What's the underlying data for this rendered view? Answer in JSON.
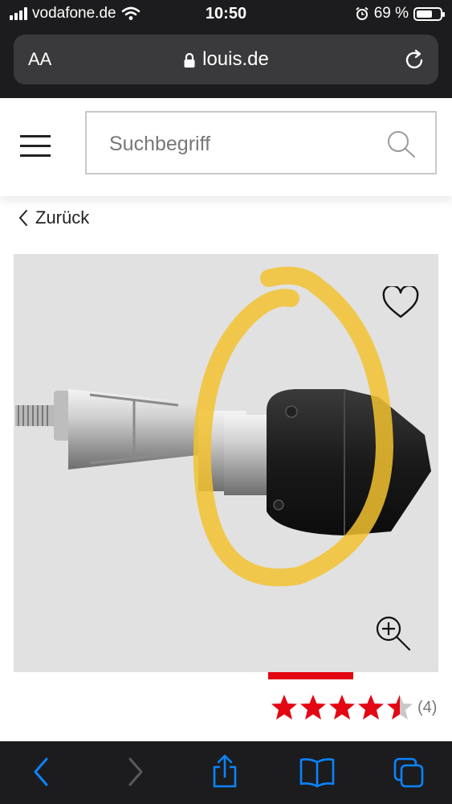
{
  "status": {
    "carrier": "vodafone.de",
    "time": "10:50",
    "battery_percent": "69 %",
    "battery_level": 0.69
  },
  "browser": {
    "text_size_label": "AA",
    "url": "louis.de"
  },
  "header": {
    "search_placeholder": "Suchbegriff"
  },
  "nav": {
    "back_label": "Zurück"
  },
  "product": {
    "rating": 4.5,
    "rating_count": "(4)"
  },
  "colors": {
    "accent_red": "#e30613",
    "star_red": "#e30613",
    "star_empty": "#c8c8c8",
    "ios_blue": "#0a84ff"
  }
}
